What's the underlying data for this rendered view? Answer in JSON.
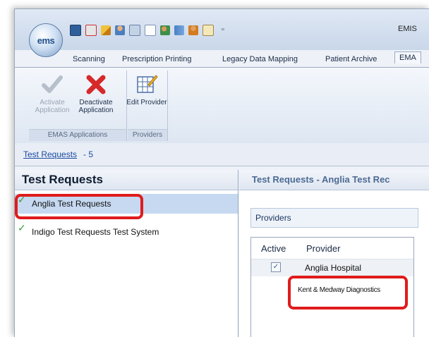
{
  "app": {
    "title": "EMIS",
    "logo_text": "ems"
  },
  "quick_access": {
    "icons": [
      "save-icon",
      "home-icon",
      "pencil-icon",
      "user-icon",
      "print-icon",
      "document-icon",
      "users-icon",
      "share-icon",
      "person-icon",
      "clipboard-icon"
    ],
    "separator": "⁼"
  },
  "tabs": [
    {
      "label": "Scanning"
    },
    {
      "label": "Prescription Printing"
    },
    {
      "label": "Legacy Data Mapping"
    },
    {
      "label": "Patient Archive"
    },
    {
      "label": "EMA"
    }
  ],
  "ribbon": {
    "emas_group": {
      "label": "EMAS Applications",
      "activate": "Activate Application",
      "deactivate": "Deactivate Application"
    },
    "providers_group": {
      "label": "Providers",
      "edit": "Edit Provider"
    }
  },
  "breadcrumb": {
    "link": "Test Requests",
    "count": "- 5"
  },
  "left_panel": {
    "title": "Test Requests",
    "items": [
      {
        "label": "Anglia Test Requests",
        "selected": true
      },
      {
        "label": "Indigo Test Requests Test System",
        "selected": false
      }
    ]
  },
  "right_panel": {
    "title": "Test Requests - Anglia Test Rec",
    "providers_label": "Providers",
    "columns": [
      "Active",
      "Provider"
    ],
    "rows": [
      {
        "active": true,
        "check": "✓",
        "provider": "Anglia Hospital"
      },
      {
        "active": false,
        "check": "",
        "provider": "Kent & Medway Diagnostics"
      }
    ]
  },
  "colors": {
    "highlight": "#e01b1b",
    "tick": "#3aa23a",
    "selection": "#c6d9f1"
  }
}
